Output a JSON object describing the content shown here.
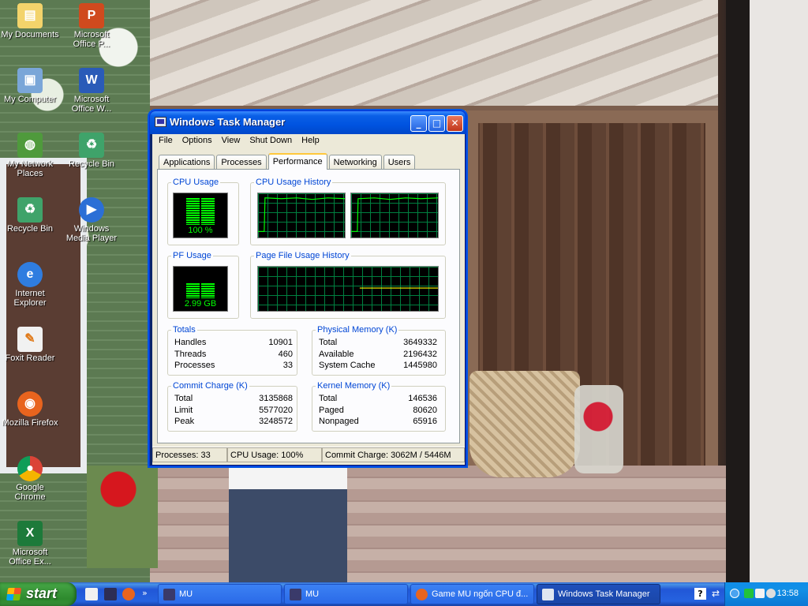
{
  "desktop": {
    "icons": [
      {
        "label": "My Documents"
      },
      {
        "label": "Microsoft Office P..."
      },
      {
        "label": "My Computer"
      },
      {
        "label": "Microsoft Office W..."
      },
      {
        "label": "My Network Places"
      },
      {
        "label": "Recycle Bin"
      },
      {
        "label": "Recycle Bin"
      },
      {
        "label": "Windows Media Player"
      },
      {
        "label": "Internet Explorer"
      },
      {
        "label": "Foxit Reader"
      },
      {
        "label": "Mozilla Firefox"
      },
      {
        "label": "Google Chrome"
      },
      {
        "label": "Microsoft Office Ex..."
      }
    ]
  },
  "window": {
    "title": "Windows Task Manager",
    "controls": {
      "minimize": "_",
      "maximize": "□",
      "close": "✕"
    },
    "menu": [
      "File",
      "Options",
      "View",
      "Shut Down",
      "Help"
    ],
    "tabs": [
      "Applications",
      "Processes",
      "Performance",
      "Networking",
      "Users"
    ],
    "active_tab": "Performance",
    "cpu_usage": {
      "label": "CPU Usage",
      "value": "100 %",
      "level": 1.0
    },
    "cpu_history": {
      "label": "CPU Usage History"
    },
    "pf_usage": {
      "label": "PF Usage",
      "value": "2.99 GB",
      "level": 0.55
    },
    "pf_history": {
      "label": "Page File Usage History"
    },
    "totals": {
      "label": "Totals",
      "rows": [
        {
          "name": "Handles",
          "value": "10901"
        },
        {
          "name": "Threads",
          "value": "460"
        },
        {
          "name": "Processes",
          "value": "33"
        }
      ]
    },
    "physical_memory": {
      "label": "Physical Memory (K)",
      "rows": [
        {
          "name": "Total",
          "value": "3649332"
        },
        {
          "name": "Available",
          "value": "2196432"
        },
        {
          "name": "System Cache",
          "value": "1445980"
        }
      ]
    },
    "commit_charge": {
      "label": "Commit Charge (K)",
      "rows": [
        {
          "name": "Total",
          "value": "3135868"
        },
        {
          "name": "Limit",
          "value": "5577020"
        },
        {
          "name": "Peak",
          "value": "3248572"
        }
      ]
    },
    "kernel_memory": {
      "label": "Kernel Memory (K)",
      "rows": [
        {
          "name": "Total",
          "value": "146536"
        },
        {
          "name": "Paged",
          "value": "80620"
        },
        {
          "name": "Nonpaged",
          "value": "65916"
        }
      ]
    },
    "status": {
      "processes": "Processes: 33",
      "cpu": "CPU Usage: 100%",
      "commit": "Commit Charge: 3062M / 5446M"
    }
  },
  "taskbar": {
    "start_label": "start",
    "tasks": [
      {
        "label": "MU"
      },
      {
        "label": "MU"
      },
      {
        "label": "Game MU ngốn CPU đ..."
      },
      {
        "label": "Windows Task Manager"
      }
    ],
    "clock": "13:58",
    "colors": {
      "accent": "#245edb",
      "graph_green": "#00ff00",
      "tab_highlight": "#ffc83c"
    }
  }
}
